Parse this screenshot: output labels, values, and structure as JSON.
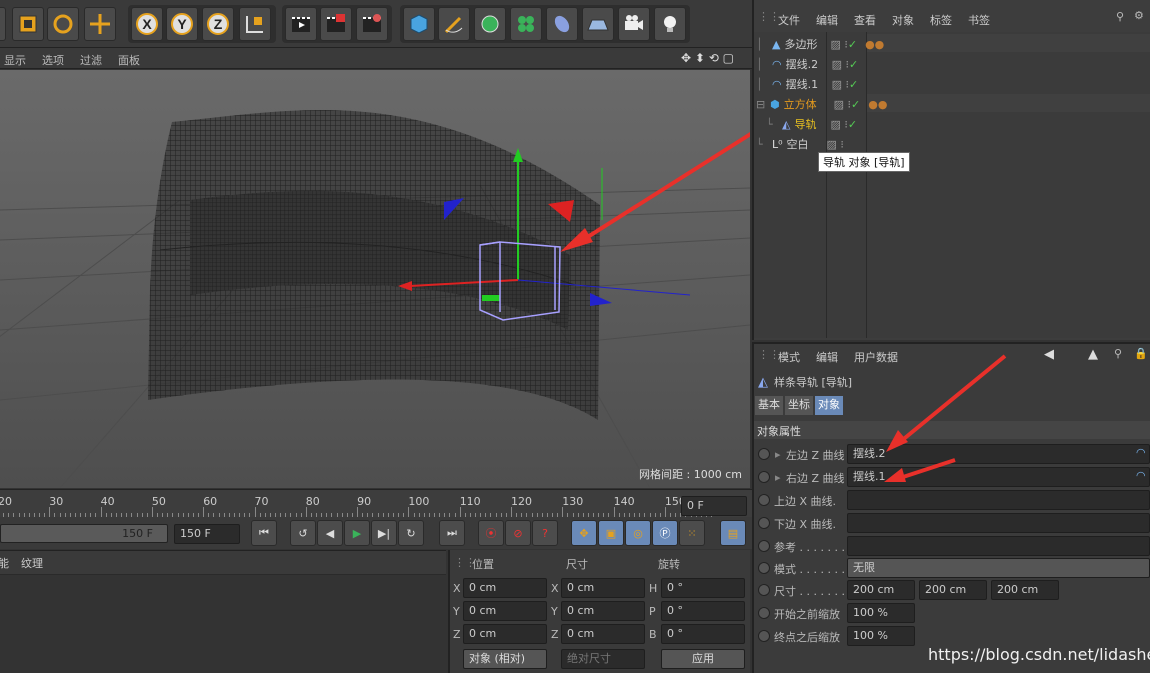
{
  "top_menu": [
    "文件",
    "编辑",
    "查看",
    "对象",
    "标签",
    "书签"
  ],
  "viewport": {
    "menu": [
      "显示",
      "选项",
      "过滤",
      "面板"
    ],
    "grid_spacing": "网格间距 : 1000 cm"
  },
  "objects": [
    {
      "name": "多边形",
      "indent": 1,
      "tags": true
    },
    {
      "name": "摆线.2",
      "indent": 1,
      "tags": false
    },
    {
      "name": "摆线.1",
      "indent": 1,
      "tags": false
    },
    {
      "name": "立方体",
      "indent": 0,
      "tags": true
    },
    {
      "name": "导轨",
      "indent": 2,
      "tags": false
    },
    {
      "name": "空白",
      "indent": 1,
      "tags": false
    }
  ],
  "tooltip": "导轨 对象 [导轨]",
  "attr": {
    "menu": [
      "模式",
      "编辑",
      "用户数据"
    ],
    "object_title": "样条导轨 [导轨]",
    "tabs": [
      "基本",
      "坐标",
      "对象"
    ],
    "section": "对象属性",
    "rows": [
      {
        "label": "左边 Z 曲线",
        "value": "摆线.2"
      },
      {
        "label": "右边 Z 曲线",
        "value": "摆线.1"
      },
      {
        "label": "上边 X 曲线.",
        "value": ""
      },
      {
        "label": "下边 X 曲线.",
        "value": ""
      },
      {
        "label": "参考 . . . . . . .",
        "value": ""
      }
    ],
    "mode_label": "模式 . . . . . . .",
    "mode_value": "无限",
    "size_label": "尺寸 . . . . . . .",
    "size": [
      "200 cm",
      "200 cm",
      "200 cm"
    ],
    "scale_start_label": "开始之前缩放",
    "scale_start": "100 %",
    "scale_end_label": "终点之后缩放",
    "scale_end": "100 %"
  },
  "timeline": {
    "ticks": [
      "20",
      "30",
      "40",
      "50",
      "60",
      "70",
      "80",
      "90",
      "100",
      "110",
      "120",
      "130",
      "140",
      "150"
    ],
    "frame": "0 F",
    "end_frame_a": "150 F",
    "end_frame_b": "150 F"
  },
  "material": {
    "menu": [
      "能",
      "纹理"
    ]
  },
  "coords": {
    "headers": [
      "位置",
      "尺寸",
      "旋转"
    ],
    "rows": [
      {
        "a": "X",
        "av": "0 cm",
        "b": "X",
        "bv": "0 cm",
        "c": "H",
        "cv": "0 °"
      },
      {
        "a": "Y",
        "av": "0 cm",
        "b": "Y",
        "bv": "0 cm",
        "c": "P",
        "cv": "0 °"
      },
      {
        "a": "Z",
        "av": "0 cm",
        "b": "Z",
        "bv": "0 cm",
        "c": "B",
        "cv": "0 °"
      }
    ],
    "mode": "对象 (相对)",
    "size_mode": "绝对尺寸",
    "apply": "应用"
  },
  "watermark": "https://blog.csdn.net/lidashent",
  "colors": {
    "accent_orange": "#e39a1e",
    "annotation_red": "#e8302a"
  }
}
